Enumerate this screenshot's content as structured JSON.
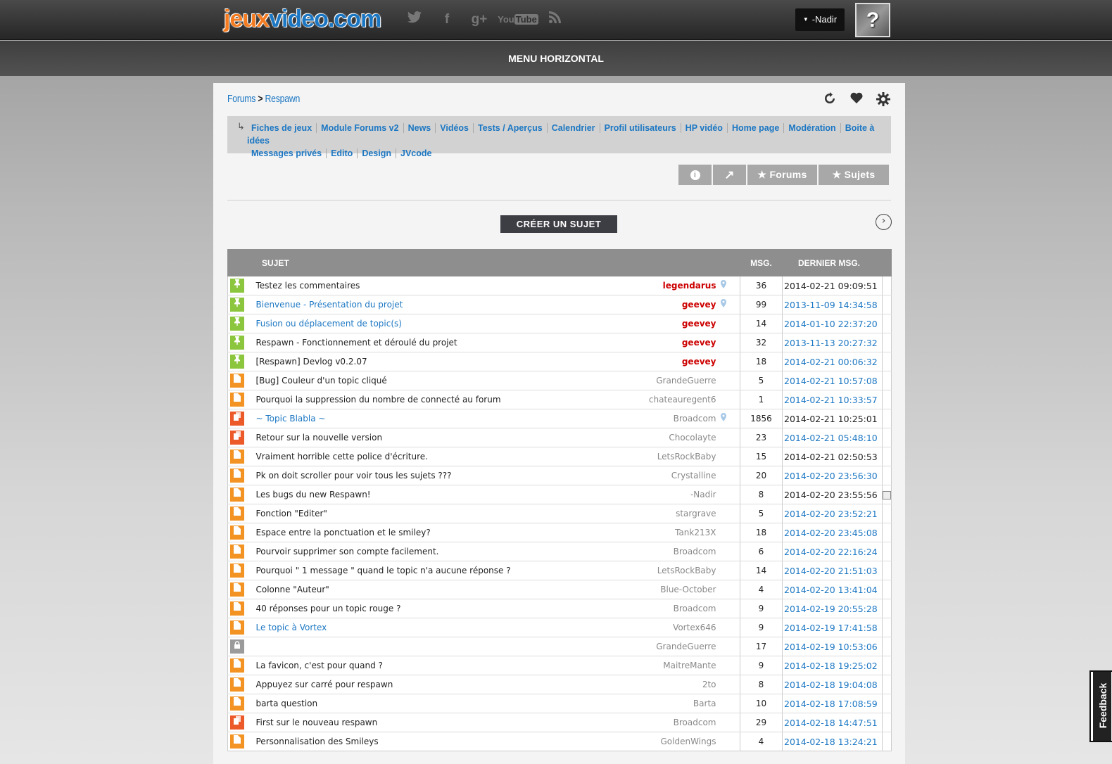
{
  "header": {
    "logo_part1": "jeux",
    "logo_part2": "video.com",
    "social": [
      "twitter",
      "facebook",
      "g+",
      "YouTube",
      "rss"
    ],
    "user_name": "-Nadir",
    "avatar_glyph": "?"
  },
  "menu": {
    "label": "MENU HORIZONTAL"
  },
  "breadcrumb": {
    "root": "Forums",
    "sep": ">",
    "current": "Respawn"
  },
  "subnav": {
    "links": [
      "Fiches de jeux",
      "Module Forums v2",
      "News",
      "Vidéos",
      "Tests / Aperçus",
      "Calendrier",
      "Profil utilisateurs",
      "HP vidéo",
      "Home page",
      "Modération",
      "Boite à idées",
      "Messages privés",
      "Edito",
      "Design",
      "JVcode"
    ]
  },
  "buttons": {
    "info": "i",
    "share": "↗",
    "forums": "★ Forums",
    "sujets": "★ Sujets",
    "create": "CRÉER UN SUJET",
    "next": "›"
  },
  "table": {
    "col_subject": "SUJET",
    "col_msg": "MSG.",
    "col_last": "DERNIER MSG.",
    "rows": [
      {
        "icon": "pin",
        "title": "Testez les commentaires",
        "author": "legendarus",
        "mod": true,
        "loc": true,
        "msg": "36",
        "date": "2014-02-21 09:09:51",
        "dlink": false,
        "tlink": false
      },
      {
        "icon": "pin",
        "title": "Bienvenue - Présentation du projet",
        "author": "geevey",
        "mod": true,
        "loc": true,
        "msg": "99",
        "date": "2013-11-09 14:34:58",
        "dlink": true,
        "tlink": true
      },
      {
        "icon": "pin",
        "title": "Fusion ou déplacement de topic(s)",
        "author": "geevey",
        "mod": true,
        "loc": false,
        "msg": "14",
        "date": "2014-01-10 22:37:20",
        "dlink": true,
        "tlink": true
      },
      {
        "icon": "pin",
        "title": "Respawn - Fonctionnement et déroulé du projet",
        "author": "geevey",
        "mod": true,
        "loc": false,
        "msg": "32",
        "date": "2013-11-13 20:27:32",
        "dlink": true,
        "tlink": false
      },
      {
        "icon": "pin",
        "title": "[Respawn] Devlog v0.2.07",
        "author": "geevey",
        "mod": true,
        "loc": false,
        "msg": "18",
        "date": "2014-02-21 00:06:32",
        "dlink": true,
        "tlink": false
      },
      {
        "icon": "doc",
        "title": "[Bug] Couleur d'un topic cliqué",
        "author": "GrandeGuerre",
        "mod": false,
        "loc": false,
        "msg": "5",
        "date": "2014-02-21 10:57:08",
        "dlink": true,
        "tlink": false
      },
      {
        "icon": "doc",
        "title": "Pourquoi la suppression du nombre de connecté au forum",
        "author": "chateauregent6",
        "mod": false,
        "loc": false,
        "msg": "1",
        "date": "2014-02-21 10:33:57",
        "dlink": true,
        "tlink": false
      },
      {
        "icon": "hot",
        "title": "~ Topic Blabla ~",
        "author": "Broadcom",
        "mod": false,
        "loc": true,
        "msg": "1856",
        "date": "2014-02-21 10:25:01",
        "dlink": false,
        "tlink": true
      },
      {
        "icon": "hot",
        "title": "Retour sur la nouvelle version",
        "author": "Chocolayte",
        "mod": false,
        "loc": false,
        "msg": "23",
        "date": "2014-02-21 05:48:10",
        "dlink": true,
        "tlink": false
      },
      {
        "icon": "doc",
        "title": "Vraiment horrible cette police d'écriture.",
        "author": "LetsRockBaby",
        "mod": false,
        "loc": false,
        "msg": "15",
        "date": "2014-02-21 02:50:53",
        "dlink": false,
        "tlink": false
      },
      {
        "icon": "doc",
        "title": "Pk on doit scroller pour voir tous les sujets ???",
        "author": "Crystalline",
        "mod": false,
        "loc": false,
        "msg": "20",
        "date": "2014-02-20 23:56:30",
        "dlink": true,
        "tlink": false
      },
      {
        "icon": "doc",
        "title": "Les bugs du new Respawn!",
        "author": "-Nadir",
        "mod": false,
        "loc": false,
        "msg": "8",
        "date": "2014-02-20 23:55:56",
        "dlink": false,
        "tlink": false,
        "check": true
      },
      {
        "icon": "doc",
        "title": "Fonction \"Editer\"",
        "author": "stargrave",
        "mod": false,
        "loc": false,
        "msg": "5",
        "date": "2014-02-20 23:52:21",
        "dlink": true,
        "tlink": false
      },
      {
        "icon": "doc",
        "title": "Espace entre la ponctuation et le smiley?",
        "author": "Tank213X",
        "mod": false,
        "loc": false,
        "msg": "18",
        "date": "2014-02-20 23:45:08",
        "dlink": true,
        "tlink": false
      },
      {
        "icon": "doc",
        "title": "Pourvoir supprimer son compte facilement.",
        "author": "Broadcom",
        "mod": false,
        "loc": false,
        "msg": "6",
        "date": "2014-02-20 22:16:24",
        "dlink": true,
        "tlink": false
      },
      {
        "icon": "doc",
        "title": "Pourquoi \" 1 message \" quand le topic n'a aucune réponse ?",
        "author": "LetsRockBaby",
        "mod": false,
        "loc": false,
        "msg": "14",
        "date": "2014-02-20 21:51:03",
        "dlink": true,
        "tlink": false
      },
      {
        "icon": "doc",
        "title": "Colonne \"Auteur\"",
        "author": "Blue-October",
        "mod": false,
        "loc": false,
        "msg": "4",
        "date": "2014-02-20 13:41:04",
        "dlink": true,
        "tlink": false
      },
      {
        "icon": "doc",
        "title": "40 réponses pour un topic rouge ?",
        "author": "Broadcom",
        "mod": false,
        "loc": false,
        "msg": "9",
        "date": "2014-02-19 20:55:28",
        "dlink": true,
        "tlink": false
      },
      {
        "icon": "doc",
        "title": "Le topic à Vortex",
        "author": "Vortex646",
        "mod": false,
        "loc": false,
        "msg": "9",
        "date": "2014-02-19 17:41:58",
        "dlink": true,
        "tlink": true
      },
      {
        "icon": "lock",
        "title": "",
        "author": "GrandeGuerre",
        "mod": false,
        "loc": false,
        "msg": "17",
        "date": "2014-02-19 10:53:06",
        "dlink": true,
        "tlink": false
      },
      {
        "icon": "doc",
        "title": "La favicon, c'est pour quand ?",
        "author": "MaitreMante",
        "mod": false,
        "loc": false,
        "msg": "9",
        "date": "2014-02-18 19:25:02",
        "dlink": true,
        "tlink": false
      },
      {
        "icon": "doc",
        "title": "Appuyez sur carré pour respawn",
        "author": "2to",
        "mod": false,
        "loc": false,
        "msg": "8",
        "date": "2014-02-18 19:04:08",
        "dlink": true,
        "tlink": false
      },
      {
        "icon": "doc",
        "title": "barta question",
        "author": "Barta",
        "mod": false,
        "loc": false,
        "msg": "10",
        "date": "2014-02-18 17:08:59",
        "dlink": true,
        "tlink": false
      },
      {
        "icon": "hot",
        "title": "First sur le nouveau respawn",
        "author": "Broadcom",
        "mod": false,
        "loc": false,
        "msg": "29",
        "date": "2014-02-18 14:47:51",
        "dlink": true,
        "tlink": false
      },
      {
        "icon": "doc",
        "title": "Personnalisation des Smileys",
        "author": "GoldenWings",
        "mod": false,
        "loc": false,
        "msg": "4",
        "date": "2014-02-18 13:24:21",
        "dlink": true,
        "tlink": false
      }
    ]
  },
  "feedback": {
    "label": "Feedback"
  }
}
